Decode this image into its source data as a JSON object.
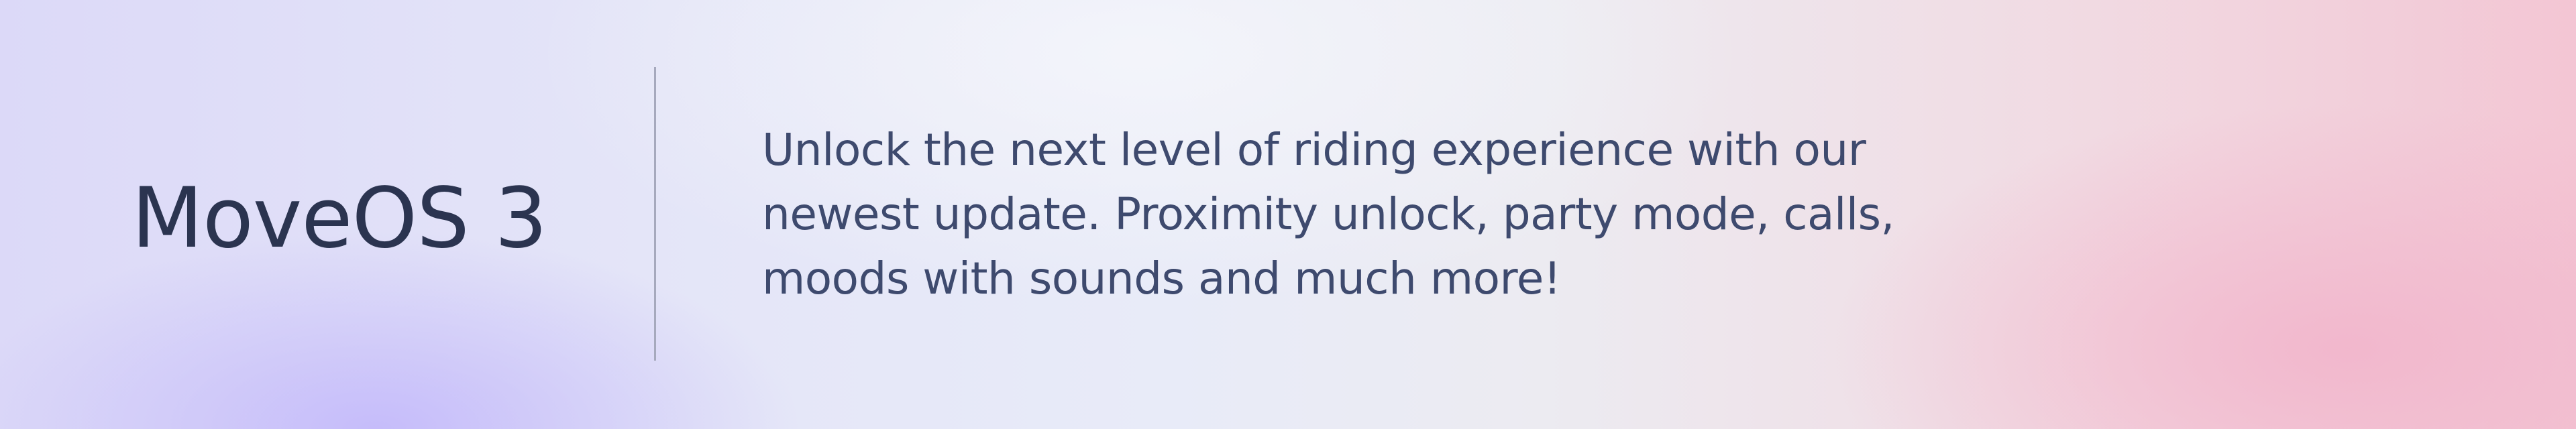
{
  "banner": {
    "title": "MoveOS 3",
    "description": "Unlock the next level of riding experience with our newest update. Proximity unlock, party mode, calls, moods with sounds and much more!"
  },
  "colors": {
    "title_text": "#2b3450",
    "body_text": "#3e4a6e",
    "divider": "#a6a9bd",
    "gradient_left": "#c4bafa",
    "gradient_right": "#f2b6cc"
  }
}
